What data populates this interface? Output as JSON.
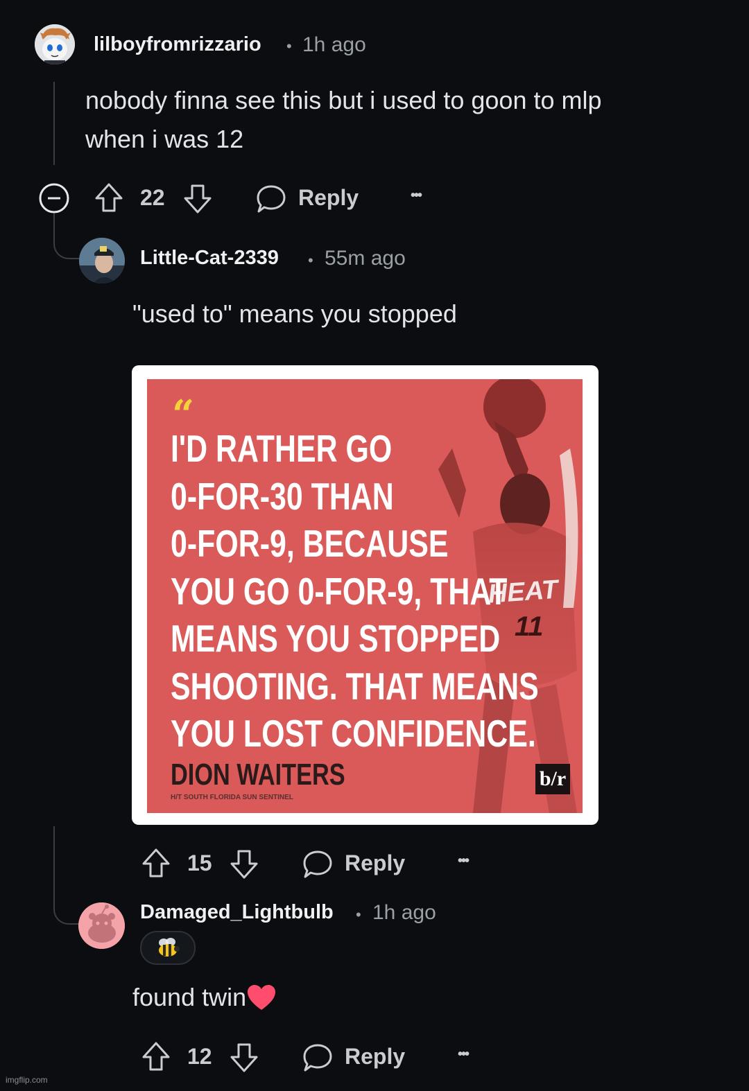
{
  "comments": [
    {
      "username": "lilboyfromrizzario",
      "separator": "•",
      "time": "1h ago",
      "lines": [
        "nobody finna see this but i used to goon to mlp",
        "when i was 12"
      ],
      "votes": "22",
      "reply_label": "Reply",
      "more": "•••"
    },
    {
      "username": "Little-Cat-2339",
      "separator": "•",
      "time": "55m ago",
      "lines": [
        "\"used to\" means you stopped"
      ],
      "votes": "15",
      "reply_label": "Reply",
      "more": "•••",
      "image": {
        "quote_mark": "“",
        "quote_lines": [
          "I'D RATHER GO",
          "0-FOR-30 THAN",
          "0-FOR-9, BECAUSE",
          "YOU GO 0-FOR-9, THAT",
          "MEANS YOU STOPPED",
          "SHOOTING. THAT MEANS",
          "YOU LOST CONFIDENCE."
        ],
        "author": "DION WAITERS",
        "credit": "H/T SOUTH FLORIDA SUN SENTINEL",
        "logo": "b/r",
        "jersey_team": "HEAT",
        "jersey_number": "11"
      }
    },
    {
      "username": "Damaged_Lightbulb",
      "separator": "•",
      "time": "1h ago",
      "flair_icon": "bee-icon",
      "text": "found twin",
      "votes": "12",
      "reply_label": "Reply",
      "more": "•••"
    }
  ],
  "watermark": "imgflip.com",
  "colors": {
    "background": "#0b0d10",
    "poster_red": "#d95a58",
    "quote_yellow": "#f5d23a",
    "heart": "#ff4d6d",
    "avatar_pink": "#f4a4a8"
  }
}
